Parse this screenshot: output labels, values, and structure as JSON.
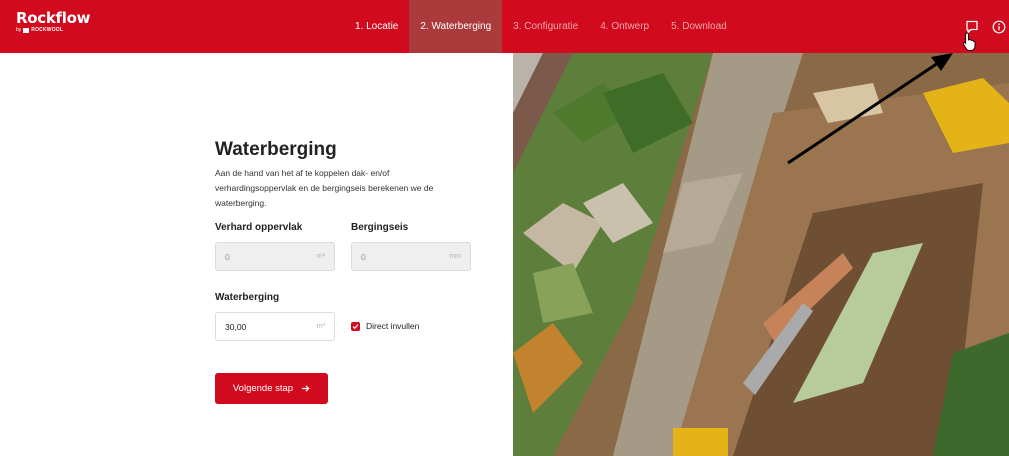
{
  "brand": {
    "name": "Rockflow",
    "by": "by",
    "company": "ROCKWOOL"
  },
  "steps": [
    {
      "label": "1. Locatie",
      "state": "done"
    },
    {
      "label": "2. Waterberging",
      "state": "active"
    },
    {
      "label": "3. Configuratie",
      "state": "pending"
    },
    {
      "label": "4. Ontwerp",
      "state": "pending"
    },
    {
      "label": "5. Download",
      "state": "pending"
    }
  ],
  "header_icons": {
    "feedback": "chat-bubble-icon",
    "info": "info-icon"
  },
  "form": {
    "title": "Waterberging",
    "description": "Aan de hand van het af te koppelen dak- en/of verhardingsoppervlak en de bergingseis berekenen we de waterberging.",
    "paved_area": {
      "label": "Verhard oppervlak",
      "value": "0",
      "unit": "m²"
    },
    "storage_requirement": {
      "label": "Bergingseis",
      "value": "0",
      "unit": "mm"
    },
    "water_storage": {
      "label": "Waterberging",
      "value": "30,00",
      "unit": "m³"
    },
    "direct_input": {
      "label": "Direct invullen",
      "checked": true
    },
    "next_button": {
      "label": "Volgende stap",
      "icon": "arrow-right-icon"
    }
  },
  "colors": {
    "brand_red": "#d20a1e",
    "active_step": "#ab3a3d",
    "pending_step_text": "#f0a7ae"
  }
}
